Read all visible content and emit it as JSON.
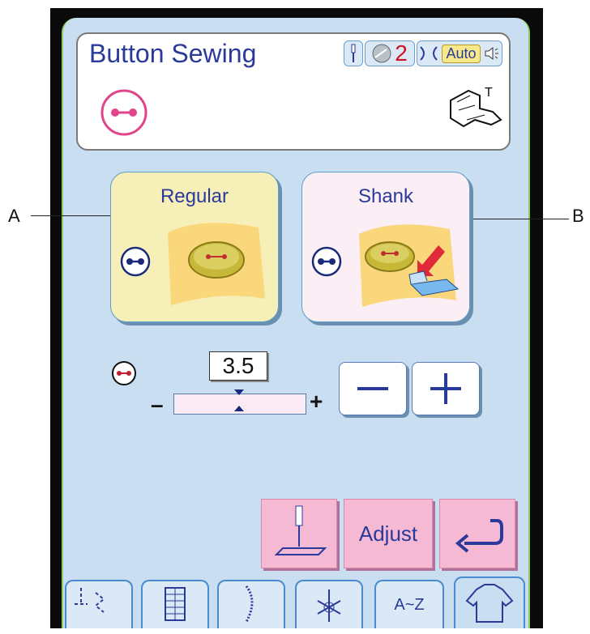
{
  "header": {
    "title": "Button Sewing",
    "needle_count": "2",
    "auto_label": "Auto",
    "foot_letter": "T"
  },
  "panels": {
    "regular_label": "Regular",
    "shank_label": "Shank"
  },
  "width_control": {
    "value": "3.5",
    "minus_sign": "–",
    "plus_sign": "+"
  },
  "buttons": {
    "adjust_label": "Adjust"
  },
  "tabs": {
    "alphabet_label": "A~Z"
  },
  "callouts": {
    "left": "A",
    "right": "B"
  },
  "colors": {
    "screen_bg": "#c9def0",
    "panel_regular": "#f7efb8",
    "panel_shank": "#fbeef4",
    "button_pink": "#f5b9d4",
    "title_blue": "#2a3a9a"
  }
}
